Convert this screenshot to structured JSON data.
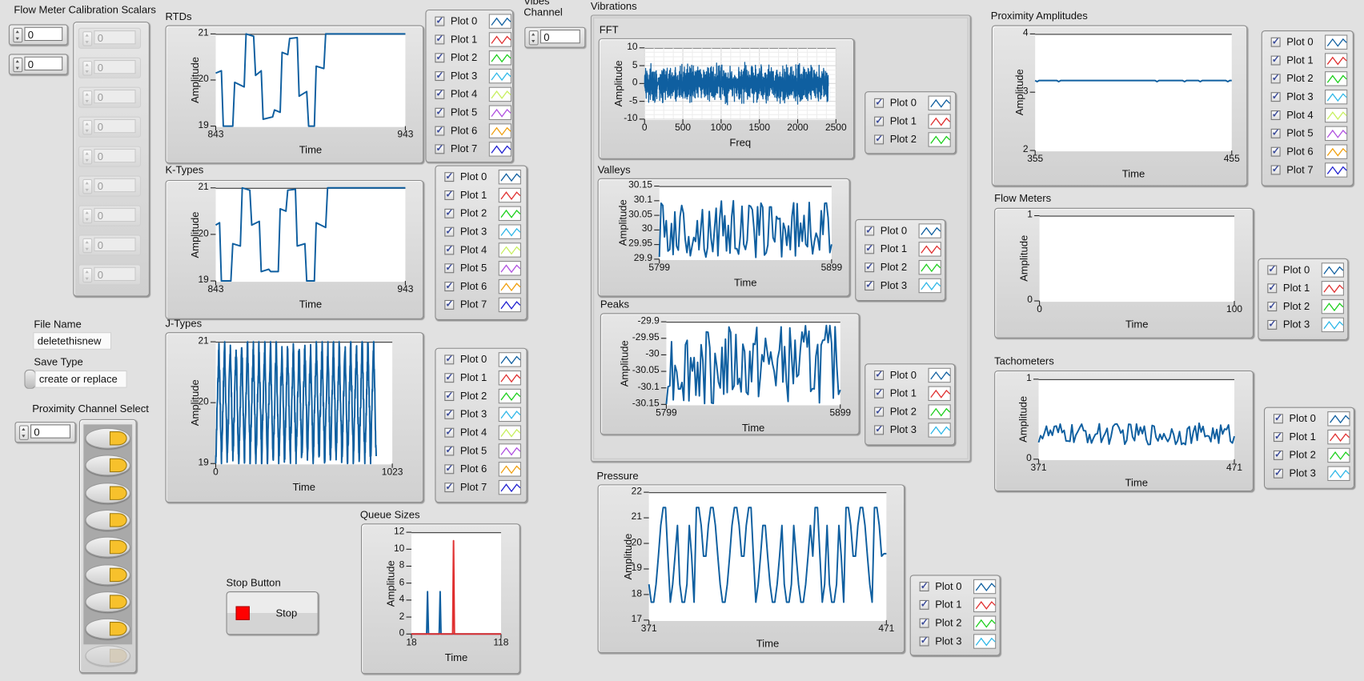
{
  "colors": {
    "plot_colors": [
      "#0f5fa0",
      "#e03030",
      "#1ed01e",
      "#30b8e8",
      "#c8f060",
      "#b050e0",
      "#f0a010",
      "#2020d0"
    ],
    "background": "#e1e1e1",
    "led_on": "#f7c12c",
    "stop_red": "#ff0000"
  },
  "flow_meter_scalars": {
    "label": "Flow Meter Calibration Scalars",
    "index_values": [
      "0",
      "0"
    ],
    "array_values": [
      "0",
      "0",
      "0",
      "0",
      "0",
      "0",
      "0",
      "0",
      "0"
    ]
  },
  "file_name": {
    "label": "File Name",
    "value": "deletethisnew"
  },
  "save_type": {
    "label": "Save Type",
    "value": "create or replace"
  },
  "proximity_channel_select": {
    "label": "Proximity Channel Select",
    "index_value": "0",
    "leds": [
      true,
      true,
      true,
      true,
      true,
      true,
      true,
      true,
      false
    ]
  },
  "stop_button": {
    "label": "Stop Button",
    "button_label": "Stop"
  },
  "vibes_channel": {
    "label_line1": "Vibes",
    "label_line2": "Channel",
    "value": "0"
  },
  "vibrations_cluster": {
    "label": "Vibrations"
  },
  "legend_labels": [
    "Plot 0",
    "Plot 1",
    "Plot 2",
    "Plot 3",
    "Plot 4",
    "Plot 5",
    "Plot 6",
    "Plot 7"
  ],
  "chart_data": [
    {
      "id": "rtds",
      "type": "line",
      "title": "RTDs",
      "xlabel": "Time",
      "ylabel": "Amplitude",
      "xlim": [
        843,
        943
      ],
      "ylim": [
        19,
        21
      ],
      "xticks": [
        "843",
        "943"
      ],
      "yticks": [
        "19",
        "20",
        "21"
      ],
      "legend": [
        "Plot 0",
        "Plot 1",
        "Plot 2",
        "Plot 3",
        "Plot 4",
        "Plot 5",
        "Plot 6",
        "Plot 7"
      ],
      "series": [
        {
          "name": "Plot 0",
          "x": [
            843,
            846,
            847,
            852,
            853,
            858,
            859,
            863,
            864,
            867,
            868,
            873,
            874,
            877,
            878,
            881,
            882,
            886,
            887,
            891,
            892,
            895,
            896,
            900,
            901,
            904,
            905,
            910,
            911,
            914,
            915,
            918,
            919,
            922,
            923,
            927,
            928,
            943
          ],
          "values": [
            20.15,
            20.2,
            19.0,
            19.0,
            19.95,
            19.85,
            21.0,
            20.95,
            20.1,
            20.2,
            19.15,
            19.2,
            19.35,
            19.3,
            20.6,
            20.55,
            20.9,
            20.92,
            19.65,
            19.75,
            19.0,
            19.0,
            20.3,
            20.25,
            21.0,
            21.0,
            21.0,
            21.0,
            21.0,
            21.0,
            21.0,
            21.0,
            21.0,
            21.0,
            21.0,
            21.0,
            21.0,
            21.0
          ]
        }
      ]
    },
    {
      "id": "ktypes",
      "type": "line",
      "title": "K-Types",
      "xlabel": "Time",
      "ylabel": "Amplitude",
      "xlim": [
        843,
        943
      ],
      "ylim": [
        19,
        21
      ],
      "xticks": [
        "843",
        "943"
      ],
      "yticks": [
        "19",
        "20",
        "21"
      ],
      "legend": [
        "Plot 0",
        "Plot 1",
        "Plot 2",
        "Plot 3",
        "Plot 4",
        "Plot 5",
        "Plot 6",
        "Plot 7"
      ],
      "series": [
        {
          "name": "Plot 0",
          "x": [
            843,
            845,
            846,
            851,
            852,
            856,
            857,
            861,
            862,
            866,
            867,
            871,
            872,
            876,
            877,
            880,
            881,
            885,
            886,
            890,
            891,
            895,
            896,
            901,
            902,
            943
          ],
          "values": [
            20.2,
            20.25,
            19.0,
            19.0,
            19.8,
            19.75,
            21.0,
            20.95,
            20.2,
            20.28,
            19.2,
            19.25,
            19.2,
            19.2,
            20.55,
            20.5,
            20.95,
            20.97,
            19.75,
            19.8,
            19.0,
            19.0,
            20.25,
            20.15,
            21.0,
            21.0
          ]
        }
      ]
    },
    {
      "id": "jtypes",
      "type": "line",
      "title": "J-Types",
      "xlabel": "Time",
      "ylabel": "Amplitude",
      "xlim": [
        0,
        1023
      ],
      "ylim": [
        19,
        21
      ],
      "xticks": [
        "0",
        "1023"
      ],
      "yticks": [
        "19",
        "20",
        "21"
      ],
      "legend": [
        "Plot 0",
        "Plot 1",
        "Plot 2",
        "Plot 3",
        "Plot 4",
        "Plot 5",
        "Plot 6",
        "Plot 7"
      ],
      "series": [
        {
          "name": "Plot 0",
          "pattern": "sawtooth oscillation between 19 and 21, ~28 cycles",
          "cycles": 28
        }
      ]
    },
    {
      "id": "fft",
      "type": "line",
      "title": "FFT",
      "xlabel": "Freq",
      "ylabel": "Amplitude",
      "xlim": [
        0,
        2500
      ],
      "ylim": [
        -10,
        10
      ],
      "grid": true,
      "xticks": [
        "0",
        "500",
        "1000",
        "1500",
        "2000",
        "2500"
      ],
      "yticks": [
        "-10",
        "-5",
        "0",
        "5",
        "10"
      ],
      "legend": [
        "Plot 0",
        "Plot 1",
        "Plot 2"
      ],
      "series": [
        {
          "name": "Plot 0",
          "pattern": "dense noise spanning about -6 to 6",
          "xmax": 2400,
          "amplitude": 6
        }
      ]
    },
    {
      "id": "valleys",
      "type": "line",
      "title": "Valleys",
      "xlabel": "Time",
      "ylabel": "Amplitude",
      "xlim": [
        5799,
        5899
      ],
      "ylim": [
        29.9,
        30.15
      ],
      "xticks": [
        "5799",
        "5899"
      ],
      "yticks": [
        "29.9",
        "29.95",
        "30",
        "30.05",
        "30.1",
        "30.15"
      ],
      "legend": [
        "Plot 0",
        "Plot 1",
        "Plot 2",
        "Plot 3"
      ],
      "series": [
        {
          "name": "Plot 0",
          "pattern": "noise between 29.9 and 30.1",
          "range": [
            29.9,
            30.1
          ]
        }
      ]
    },
    {
      "id": "peaks",
      "type": "line",
      "title": "Peaks",
      "xlabel": "Time",
      "ylabel": "Amplitude",
      "xlim": [
        5799,
        5899
      ],
      "ylim": [
        -30.15,
        -29.9
      ],
      "xticks": [
        "5799",
        "5899"
      ],
      "yticks": [
        "-30.15",
        "-30.1",
        "-30.05",
        "-30",
        "-29.95",
        "-29.9"
      ],
      "legend": [
        "Plot 0",
        "Plot 1",
        "Plot 2",
        "Plot 3"
      ],
      "series": [
        {
          "name": "Plot 0",
          "pattern": "noise between -30.15 and -29.91",
          "range": [
            -30.15,
            -29.91
          ]
        }
      ]
    },
    {
      "id": "pressure",
      "type": "line",
      "title": "Pressure",
      "xlabel": "Time",
      "ylabel": "Amplitude",
      "xlim": [
        371,
        471
      ],
      "ylim": [
        17,
        22
      ],
      "xticks": [
        "371",
        "471"
      ],
      "yticks": [
        "17",
        "18",
        "19",
        "20",
        "21",
        "22"
      ],
      "legend": [
        "Plot 0",
        "Plot 1",
        "Plot 2",
        "Plot 3"
      ],
      "series": [
        {
          "name": "Plot 0",
          "x": [
            371,
            372,
            373,
            374,
            375,
            376,
            377,
            378,
            379,
            380,
            381,
            382,
            383,
            384,
            385,
            386,
            387,
            388,
            389,
            390,
            391,
            392,
            393,
            394,
            395,
            396,
            397,
            398,
            399,
            400,
            401,
            402,
            403,
            404,
            405,
            406,
            407,
            408,
            409,
            410,
            411,
            412,
            413,
            414,
            415,
            416,
            417,
            418,
            419,
            420,
            421,
            422,
            423,
            424,
            425,
            426,
            427,
            428,
            429,
            430,
            431,
            432,
            433,
            434,
            435,
            436,
            437,
            438,
            439,
            440,
            441,
            442,
            443,
            444,
            445,
            446,
            447,
            448,
            449,
            450,
            451,
            452,
            453,
            454,
            455,
            456,
            457,
            458,
            459,
            460,
            461,
            462,
            463,
            464,
            465,
            466,
            467,
            468,
            469,
            470,
            471
          ],
          "values": [
            18.4,
            17.7,
            17.7,
            18.4,
            19.5,
            20.7,
            21.4,
            21.4,
            19.5,
            17.7,
            18.4,
            19.5,
            20.7,
            18.4,
            17.7,
            17.7,
            18.4,
            20.7,
            19.5,
            17.7,
            21.4,
            21.4,
            20.7,
            19.5,
            19.5,
            20.7,
            21.4,
            21.4,
            20.7,
            19.5,
            18.4,
            17.7,
            17.7,
            18.4,
            19.5,
            20.7,
            21.4,
            21.4,
            20.7,
            19.5,
            19.5,
            20.7,
            21.4,
            21.4,
            19.5,
            17.7,
            18.4,
            19.5,
            20.7,
            20.7,
            19.5,
            18.4,
            17.7,
            17.7,
            18.4,
            19.5,
            20.7,
            18.4,
            17.7,
            17.7,
            18.4,
            20.7,
            19.5,
            18.4,
            17.7,
            17.7,
            18.4,
            19.5,
            20.7,
            19.5,
            21.4,
            21.4,
            19.5,
            17.7,
            18.4,
            20.7,
            18.4,
            17.7,
            17.7,
            18.4,
            20.7,
            19.5,
            17.7,
            21.4,
            21.4,
            20.7,
            19.5,
            19.5,
            20.7,
            21.4,
            21.4,
            20.7,
            19.5,
            18.4,
            17.7,
            21.4,
            21.4,
            20.7,
            19.5,
            19.6,
            19.6
          ]
        }
      ]
    },
    {
      "id": "queue_sizes",
      "type": "line",
      "title": "Queue Sizes",
      "xlabel": "Time",
      "ylabel": "Amplitude",
      "xlim": [
        18,
        118
      ],
      "ylim": [
        0,
        12
      ],
      "xticks": [
        "18",
        "118"
      ],
      "yticks": [
        "0",
        "2",
        "4",
        "6",
        "8",
        "10",
        "12"
      ],
      "series": [
        {
          "name": "Plot 0",
          "x": [
            18,
            35,
            36,
            37,
            49,
            50,
            51,
            118
          ],
          "values": [
            0,
            0,
            5,
            0,
            0,
            5,
            0,
            0
          ]
        },
        {
          "name": "Plot 1",
          "x": [
            18,
            64,
            64.5,
            65,
            65.5,
            66,
            118
          ],
          "values": [
            0,
            0,
            5.5,
            11,
            5.5,
            0,
            0
          ]
        }
      ]
    },
    {
      "id": "proximity_amplitudes",
      "type": "line",
      "title": "Proximity Amplitudes",
      "xlabel": "Time",
      "ylabel": "Amplitude",
      "xlim": [
        355,
        455
      ],
      "ylim": [
        2,
        4
      ],
      "xticks": [
        "355",
        "455"
      ],
      "yticks": [
        "2",
        "3",
        "4"
      ],
      "legend": [
        "Plot 0",
        "Plot 1",
        "Plot 2",
        "Plot 3",
        "Plot 4",
        "Plot 5",
        "Plot 6",
        "Plot 7"
      ],
      "series": [
        {
          "name": "Plot 0",
          "pattern": "nearly flat at about 3.2",
          "level": 3.2
        }
      ]
    },
    {
      "id": "flow_meters",
      "type": "line",
      "title": "Flow Meters",
      "xlabel": "Time",
      "ylabel": "Amplitude",
      "xlim": [
        0,
        100
      ],
      "ylim": [
        0,
        1
      ],
      "xticks": [
        "0",
        "100"
      ],
      "yticks": [
        "0",
        "1"
      ],
      "legend": [
        "Plot 0",
        "Plot 1",
        "Plot 2",
        "Plot 3"
      ],
      "series": []
    },
    {
      "id": "tachometers",
      "type": "line",
      "title": "Tachometers",
      "xlabel": "Time",
      "ylabel": "Amplitude",
      "xlim": [
        371,
        471
      ],
      "ylim": [
        0,
        1
      ],
      "xticks": [
        "371",
        "471"
      ],
      "yticks": [
        "0",
        "1"
      ],
      "legend": [
        "Plot 0",
        "Plot 1",
        "Plot 2",
        "Plot 3"
      ],
      "series": [
        {
          "name": "Plot 0",
          "pattern": "noise between about 0.18 and 0.45",
          "range": [
            0.18,
            0.45
          ]
        }
      ]
    }
  ]
}
